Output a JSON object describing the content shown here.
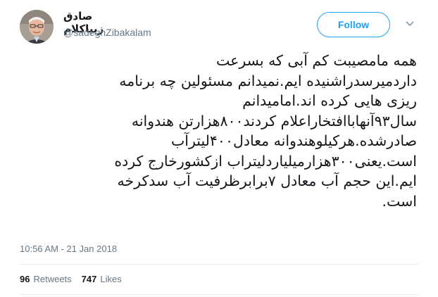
{
  "user": {
    "display_name": "صادق زیباکلام",
    "handle": "@sadeghZibakalam",
    "avatar_icon": "profile-photo"
  },
  "follow_button": {
    "label": "Follow"
  },
  "menu_icon": "chevron-down-icon",
  "tweet": {
    "lines": [
      "همه مامصیبت کم آبی که بسرعت",
      "داردمیرسدراشنیده ایم.نمیدانم مسئولین چه برنامه",
      "ریزی هایی کرده اند.امامیدانم",
      "سال۹۳آنهاباافتخاراعلام کردند۸۰۰هزارتن هندوانه",
      "صادرشده.هرکیلوهندوانه معادل۴۰۰لیترآب",
      "است.یعنی۳۰۰هزارمیلیاردلیتراب ازکشورخارج کرده",
      "ایم.این حجم آب معادل ۷برابرظرفیت آب سدکرخه",
      "است."
    ]
  },
  "timestamp": "10:56 AM - 21 Jan 2018",
  "stats": {
    "retweets_count": "96",
    "retweets_label": "Retweets",
    "likes_count": "747",
    "likes_label": "Likes"
  },
  "colors": {
    "accent": "#1da1f2",
    "text": "#14171a",
    "secondary": "#657786",
    "divider": "#e6ecf0"
  }
}
